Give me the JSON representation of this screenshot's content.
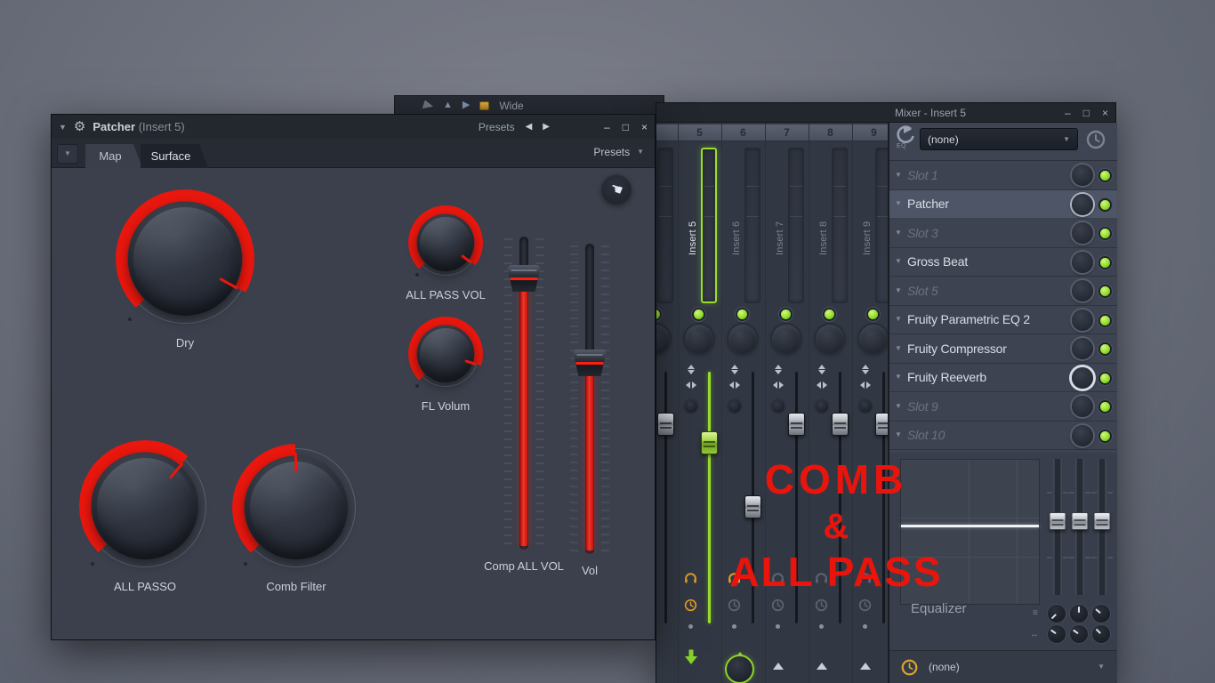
{
  "overlay": {
    "lines": [
      "COMB",
      "&",
      "ALL PASS"
    ],
    "color": "#e9150c"
  },
  "wrapper_toolbar": {
    "label": "Wide"
  },
  "patcher": {
    "titlebar": {
      "title": "Patcher",
      "subtitle": "(Insert 5)",
      "presets_label": "Presets",
      "prev_glyph": "◀",
      "next_glyph": "▶",
      "minimize_glyph": "–",
      "maximize_glyph": "□",
      "close_glyph": "×"
    },
    "tabs": [
      {
        "label": "Map",
        "active": false
      },
      {
        "label": "Surface",
        "active": true
      }
    ],
    "tabbar_presets_label": "Presets",
    "knobs": [
      {
        "id": "dry",
        "label": "Dry",
        "sweep_deg": 254,
        "pointer_deg": 119
      },
      {
        "id": "all-pass-vol",
        "label": "ALL PASS VOL",
        "sweep_deg": 262,
        "pointer_deg": 127
      },
      {
        "id": "fl-volum",
        "label": "FL Volum",
        "sweep_deg": 243,
        "pointer_deg": 108
      },
      {
        "id": "all-passo",
        "label": "ALL PASSO",
        "sweep_deg": 176,
        "pointer_deg": 41
      },
      {
        "id": "comb-filter",
        "label": "Comb Filter",
        "sweep_deg": 134,
        "pointer_deg": -1
      }
    ],
    "sliders": [
      {
        "id": "comp-all-vol",
        "label": "Comp ALL VOL",
        "value_pos": 0.1
      },
      {
        "id": "vol",
        "label": "Vol",
        "value_pos": 0.374
      }
    ]
  },
  "mixer": {
    "title": "Mixer - Insert 5",
    "minimize_glyph": "–",
    "maximize_glyph": "□",
    "close_glyph": "×",
    "input_icon_label": "EQ",
    "top_dropdown": {
      "value": "(none)"
    },
    "channels": [
      {
        "number": "",
        "name": "",
        "selected": false,
        "fader_pos": 0.18,
        "phones": "gray",
        "clock": "gray",
        "bottom": "caret"
      },
      {
        "number": "5",
        "name": "Insert 5",
        "selected": true,
        "fader_pos": 0.26,
        "phones": "orange",
        "clock": "orange",
        "bottom": "arrow-down"
      },
      {
        "number": "6",
        "name": "Insert 6",
        "selected": false,
        "fader_pos": 0.54,
        "phones": "orange",
        "clock": "gray",
        "bottom": "route-knob"
      },
      {
        "number": "7",
        "name": "Insert 7",
        "selected": false,
        "fader_pos": 0.18,
        "phones": "gray",
        "clock": "gray",
        "bottom": "caret"
      },
      {
        "number": "8",
        "name": "Insert 8",
        "selected": false,
        "fader_pos": 0.18,
        "phones": "gray",
        "clock": "gray",
        "bottom": "caret"
      },
      {
        "number": "9",
        "name": "Insert 9",
        "selected": false,
        "fader_pos": 0.18,
        "phones": "gray",
        "clock": "gray",
        "bottom": "caret"
      }
    ],
    "slots": [
      {
        "label": "Slot 1",
        "empty": true,
        "selected": false,
        "ring": "dim"
      },
      {
        "label": "Patcher",
        "empty": false,
        "selected": true,
        "ring": "bright"
      },
      {
        "label": "Slot 3",
        "empty": true,
        "selected": false,
        "ring": "dim"
      },
      {
        "label": "Gross Beat",
        "empty": false,
        "selected": false,
        "ring": "dim"
      },
      {
        "label": "Slot 5",
        "empty": true,
        "selected": false,
        "ring": "dim"
      },
      {
        "label": "Fruity Parametric EQ 2",
        "empty": false,
        "selected": false,
        "ring": "dim"
      },
      {
        "label": "Fruity Compressor",
        "empty": false,
        "selected": false,
        "ring": "dim"
      },
      {
        "label": "Fruity Reeverb",
        "empty": false,
        "selected": false,
        "ring": "brightest"
      },
      {
        "label": "Slot 9",
        "empty": true,
        "selected": false,
        "ring": "dim"
      },
      {
        "label": "Slot 10",
        "empty": true,
        "selected": false,
        "ring": "dim"
      }
    ],
    "equalizer": {
      "label": "Equalizer",
      "row_icons": [
        "≡",
        "↔"
      ],
      "bands": [
        {
          "pos": 0.45
        },
        {
          "pos": 0.45
        },
        {
          "pos": 0.45
        }
      ],
      "knobs": [
        {
          "angle": -135
        },
        {
          "angle": 0
        },
        {
          "angle": -50
        },
        {
          "angle": -55
        },
        {
          "angle": -55
        },
        {
          "angle": -45
        }
      ]
    },
    "bottom_dropdown": {
      "value": "(none)"
    }
  }
}
